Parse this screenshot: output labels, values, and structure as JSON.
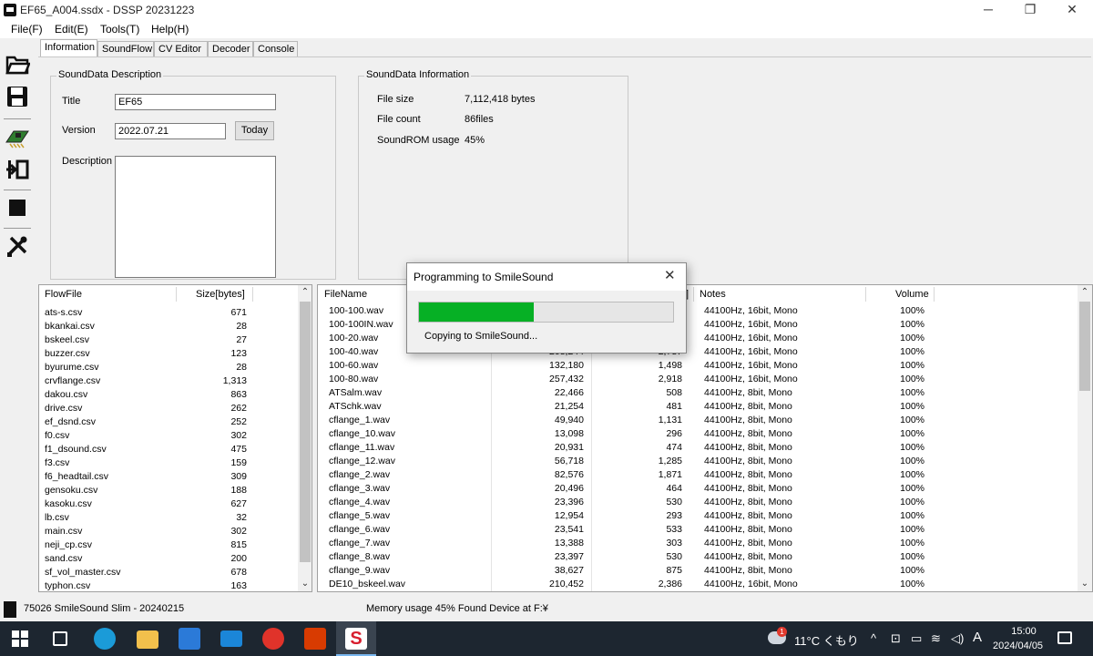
{
  "window": {
    "title": "EF65_A004.ssdx - DSSP 20231223",
    "minimize": "─",
    "maximize": "❐",
    "close": "✕"
  },
  "menu": [
    "File(F)",
    "Edit(E)",
    "Tools(T)",
    "Help(H)"
  ],
  "tabs": [
    "Information",
    "SoundFlow",
    "CV Editor",
    "Decoder",
    "Console"
  ],
  "description": {
    "group_title": "SoundData Description",
    "title_label": "Title",
    "title_value": "EF65",
    "version_label": "Version",
    "version_value": "2022.07.21",
    "today_button": "Today",
    "description_label": "Description",
    "description_value": ""
  },
  "information": {
    "group_title": "SoundData Information",
    "file_size_label": "File size",
    "file_size_value": "7,112,418 bytes",
    "file_count_label": "File count",
    "file_count_value": "86files",
    "rom_usage_label": "SoundROM usage",
    "rom_usage_value": "45%"
  },
  "flow_list": {
    "headers": [
      "FlowFile",
      "Size[bytes]"
    ],
    "rows": [
      [
        "ats-s.csv",
        "671"
      ],
      [
        "bkankai.csv",
        "28"
      ],
      [
        "bskeel.csv",
        "27"
      ],
      [
        "buzzer.csv",
        "123"
      ],
      [
        "byurume.csv",
        "28"
      ],
      [
        "crvflange.csv",
        "1,313"
      ],
      [
        "dakou.csv",
        "863"
      ],
      [
        "drive.csv",
        "262"
      ],
      [
        "ef_dsnd.csv",
        "252"
      ],
      [
        "f0.csv",
        "302"
      ],
      [
        "f1_dsound.csv",
        "475"
      ],
      [
        "f3.csv",
        "159"
      ],
      [
        "f6_headtail.csv",
        "309"
      ],
      [
        "gensoku.csv",
        "188"
      ],
      [
        "kasoku.csv",
        "627"
      ],
      [
        "lb.csv",
        "32"
      ],
      [
        "main.csv",
        "302"
      ],
      [
        "neji_cp.csv",
        "815"
      ],
      [
        "sand.csv",
        "200"
      ],
      [
        "sf_vol_master.csv",
        "678"
      ],
      [
        "typhon.csv",
        "163"
      ]
    ]
  },
  "file_list": {
    "headers": [
      "FileName",
      "]",
      "Notes",
      "Volume"
    ],
    "rows": [
      [
        "100-100.wav",
        "",
        "",
        "44100Hz, 16bit, Mono",
        "100%"
      ],
      [
        "100-100IN.wav",
        "",
        "",
        "44100Hz, 16bit, Mono",
        "100%"
      ],
      [
        "100-20.wav",
        "",
        "",
        "44100Hz, 16bit, Mono",
        "100%"
      ],
      [
        "100-40.wav",
        "208,244",
        "2,787",
        "44100Hz, 16bit, Mono",
        "100%"
      ],
      [
        "100-60.wav",
        "132,180",
        "1,498",
        "44100Hz, 16bit, Mono",
        "100%"
      ],
      [
        "100-80.wav",
        "257,432",
        "2,918",
        "44100Hz, 16bit, Mono",
        "100%"
      ],
      [
        "ATSalm.wav",
        "22,466",
        "508",
        "44100Hz, 8bit, Mono",
        "100%"
      ],
      [
        "ATSchk.wav",
        "21,254",
        "481",
        "44100Hz, 8bit, Mono",
        "100%"
      ],
      [
        "cflange_1.wav",
        "49,940",
        "1,131",
        "44100Hz, 8bit, Mono",
        "100%"
      ],
      [
        "cflange_10.wav",
        "13,098",
        "296",
        "44100Hz, 8bit, Mono",
        "100%"
      ],
      [
        "cflange_11.wav",
        "20,931",
        "474",
        "44100Hz, 8bit, Mono",
        "100%"
      ],
      [
        "cflange_12.wav",
        "56,718",
        "1,285",
        "44100Hz, 8bit, Mono",
        "100%"
      ],
      [
        "cflange_2.wav",
        "82,576",
        "1,871",
        "44100Hz, 8bit, Mono",
        "100%"
      ],
      [
        "cflange_3.wav",
        "20,496",
        "464",
        "44100Hz, 8bit, Mono",
        "100%"
      ],
      [
        "cflange_4.wav",
        "23,396",
        "530",
        "44100Hz, 8bit, Mono",
        "100%"
      ],
      [
        "cflange_5.wav",
        "12,954",
        "293",
        "44100Hz, 8bit, Mono",
        "100%"
      ],
      [
        "cflange_6.wav",
        "23,541",
        "533",
        "44100Hz, 8bit, Mono",
        "100%"
      ],
      [
        "cflange_7.wav",
        "13,388",
        "303",
        "44100Hz, 8bit, Mono",
        "100%"
      ],
      [
        "cflange_8.wav",
        "23,397",
        "530",
        "44100Hz, 8bit, Mono",
        "100%"
      ],
      [
        "cflange_9.wav",
        "38,627",
        "875",
        "44100Hz, 8bit, Mono",
        "100%"
      ],
      [
        "DE10_bskeel.wav",
        "210,452",
        "2,386",
        "44100Hz, 16bit, Mono",
        "100%"
      ]
    ]
  },
  "dialog": {
    "title": "Programming to SmileSound",
    "close": "✕",
    "progress": 0.45,
    "message": "Copying to SmileSound..."
  },
  "status": {
    "device": "75026 SmileSound Slim - 20240215",
    "memory": "Memory usage 45%  Found Device at F:¥"
  },
  "taskbar": {
    "weather_badge": "1",
    "weather": "11°C くもり",
    "ime": "A",
    "time": "15:00",
    "date": "2024/04/05"
  },
  "colors": {
    "progress": "#06b025",
    "taskbar": "#1d2630"
  }
}
